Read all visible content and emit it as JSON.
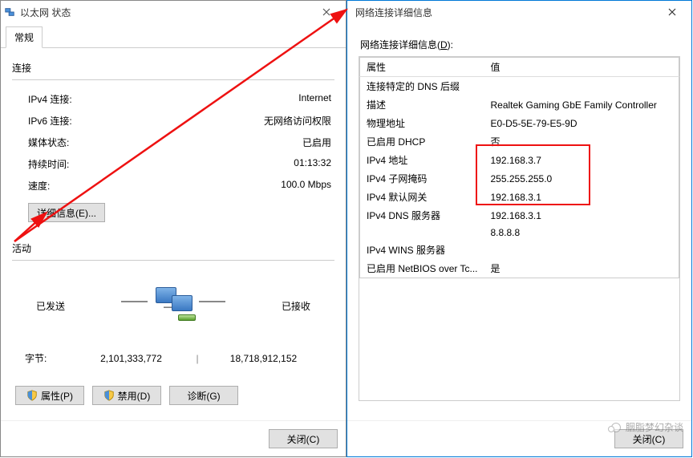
{
  "left": {
    "title": "以太网 状态",
    "tab_general": "常规",
    "section_connection": "连接",
    "rows": {
      "ipv4_label": "IPv4 连接:",
      "ipv4_value": "Internet",
      "ipv6_label": "IPv6 连接:",
      "ipv6_value": "无网络访问权限",
      "media_label": "媒体状态:",
      "media_value": "已启用",
      "duration_label": "持续时间:",
      "duration_value": "01:13:32",
      "speed_label": "速度:",
      "speed_value": "100.0 Mbps"
    },
    "details_btn": "详细信息(E)...",
    "section_activity": "活动",
    "sent_label": "已发送",
    "recv_label": "已接收",
    "bytes_label": "字节:",
    "bytes_sent": "2,101,333,772",
    "bytes_recv": "18,718,912,152",
    "btn_props": "属性(P)",
    "btn_disable": "禁用(D)",
    "btn_diag": "诊断(G)",
    "btn_close": "关闭(C)"
  },
  "right": {
    "title": "网络连接详细信息",
    "label_pre": "网络连接详细信息(",
    "label_u": "D",
    "label_post": "):",
    "col_prop": "属性",
    "col_val": "值",
    "rows": [
      {
        "p": "连接特定的 DNS 后缀",
        "v": ""
      },
      {
        "p": "描述",
        "v": "Realtek Gaming GbE Family Controller"
      },
      {
        "p": "物理地址",
        "v": "E0-D5-5E-79-E5-9D"
      },
      {
        "p": "已启用 DHCP",
        "v": "否"
      },
      {
        "p": "IPv4 地址",
        "v": "192.168.3.7"
      },
      {
        "p": "IPv4 子网掩码",
        "v": "255.255.255.0"
      },
      {
        "p": "IPv4 默认网关",
        "v": "192.168.3.1"
      },
      {
        "p": "IPv4 DNS 服务器",
        "v": "192.168.3.1"
      },
      {
        "p": "",
        "v": "8.8.8.8"
      },
      {
        "p": "IPv4 WINS 服务器",
        "v": ""
      },
      {
        "p": "已启用 NetBIOS over Tc...",
        "v": "是"
      }
    ],
    "btn_close": "关闭(C)"
  },
  "watermark": "胭脂梦幻杂谈"
}
